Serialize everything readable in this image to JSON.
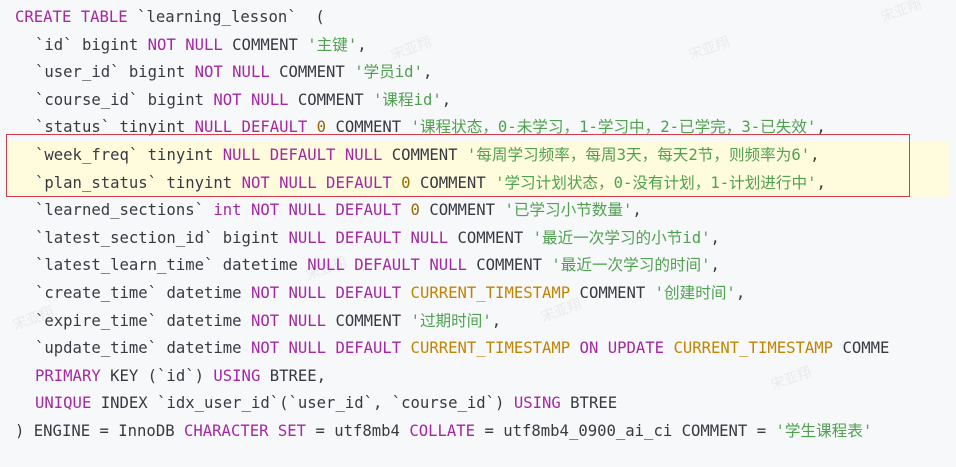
{
  "watermark": "宋亚翔",
  "sql": {
    "create_kw": "CREATE TABLE",
    "table_name": " `learning_lesson`  (",
    "columns": {
      "id": {
        "name": "`id`",
        "type": " bigint ",
        "c1": "NOT NULL",
        "comment_kw": " COMMENT ",
        "comment": "'主键'",
        "end": ","
      },
      "user_id": {
        "name": "`user_id`",
        "type": " bigint ",
        "c1": "NOT NULL",
        "comment_kw": " COMMENT ",
        "comment": "'学员id'",
        "end": ","
      },
      "course_id": {
        "name": "`course_id`",
        "type": " bigint ",
        "c1": "NOT NULL",
        "comment_kw": " COMMENT ",
        "comment": "'课程id'",
        "end": ","
      },
      "status": {
        "name": "`status`",
        "type": " tinyint ",
        "c1": "NULL DEFAULT",
        "num": " 0",
        "comment_kw": " COMMENT ",
        "comment": "'课程状态，0-未学习，1-学习中，2-已学完，3-已失效'",
        "end": ","
      },
      "week_freq": {
        "name": "`week_freq`",
        "type": " tinyint ",
        "c1": "NULL DEFAULT NULL",
        "comment_kw": " COMMENT ",
        "comment": "'每周学习频率，每周3天，每天2节，则频率为6'",
        "end": ","
      },
      "plan_status": {
        "name": "`plan_status`",
        "type": " tinyint ",
        "c1": "NOT NULL DEFAULT",
        "num": " 0",
        "comment_kw": " COMMENT ",
        "comment": "'学习计划状态，0-没有计划，1-计划进行中'",
        "end": ","
      },
      "learned_sections": {
        "name": "`learned_sections`",
        "type_kw": "int",
        "c1": " NOT NULL DEFAULT",
        "num": " 0",
        "comment_kw": " COMMENT ",
        "comment": "'已学习小节数量'",
        "end": ","
      },
      "latest_section_id": {
        "name": "`latest_section_id`",
        "type": " bigint ",
        "c1": "NULL DEFAULT NULL",
        "comment_kw": " COMMENT ",
        "comment": "'最近一次学习的小节id'",
        "end": ","
      },
      "latest_learn_time": {
        "name": "`latest_learn_time`",
        "type": " datetime ",
        "c1": "NULL DEFAULT NULL",
        "comment_kw": " COMMENT ",
        "comment": "'最近一次学习的时间'",
        "end": ","
      },
      "create_time": {
        "name": "`create_time`",
        "type": " datetime ",
        "c1": "NOT NULL DEFAULT",
        "fn": " CURRENT_TIMESTAMP",
        "comment_kw": " COMMENT ",
        "comment": "'创建时间'",
        "end": ","
      },
      "expire_time": {
        "name": "`expire_time`",
        "type": " datetime ",
        "c1": "NOT NULL",
        "comment_kw": " COMMENT ",
        "comment": "'过期时间'",
        "end": ","
      },
      "update_time": {
        "name": "`update_time`",
        "type": " datetime ",
        "c1": "NOT NULL DEFAULT",
        "fn": " CURRENT_TIMESTAMP",
        "kw2": " ON UPDATE",
        "fn2": " CURRENT_TIMESTAMP",
        "tail": " COMME"
      }
    },
    "primary_kw": "PRIMARY",
    "primary_rest": " KEY (`id`) ",
    "using_kw": "USING",
    "btree": " BTREE,",
    "unique_kw": "UNIQUE",
    "unique_rest": " INDEX `idx_user_id`(`user_id`, `course_id`) ",
    "btree2": " BTREE",
    "engine_rest": ") ENGINE = InnoDB ",
    "charset_kw": "CHARACTER SET",
    "charset_val": " = utf8mb4 ",
    "collate_kw": "COLLATE",
    "collate_val": " = utf8mb4_0900_ai_ci COMMENT = ",
    "table_comment": "'学生课程表'"
  },
  "colors": {
    "keyword": "#a626a4",
    "string": "#50a14f",
    "number": "#986801",
    "function": "#c18401",
    "highlight_border": "#d73a49",
    "highlight_bg": "#fffbdd"
  }
}
